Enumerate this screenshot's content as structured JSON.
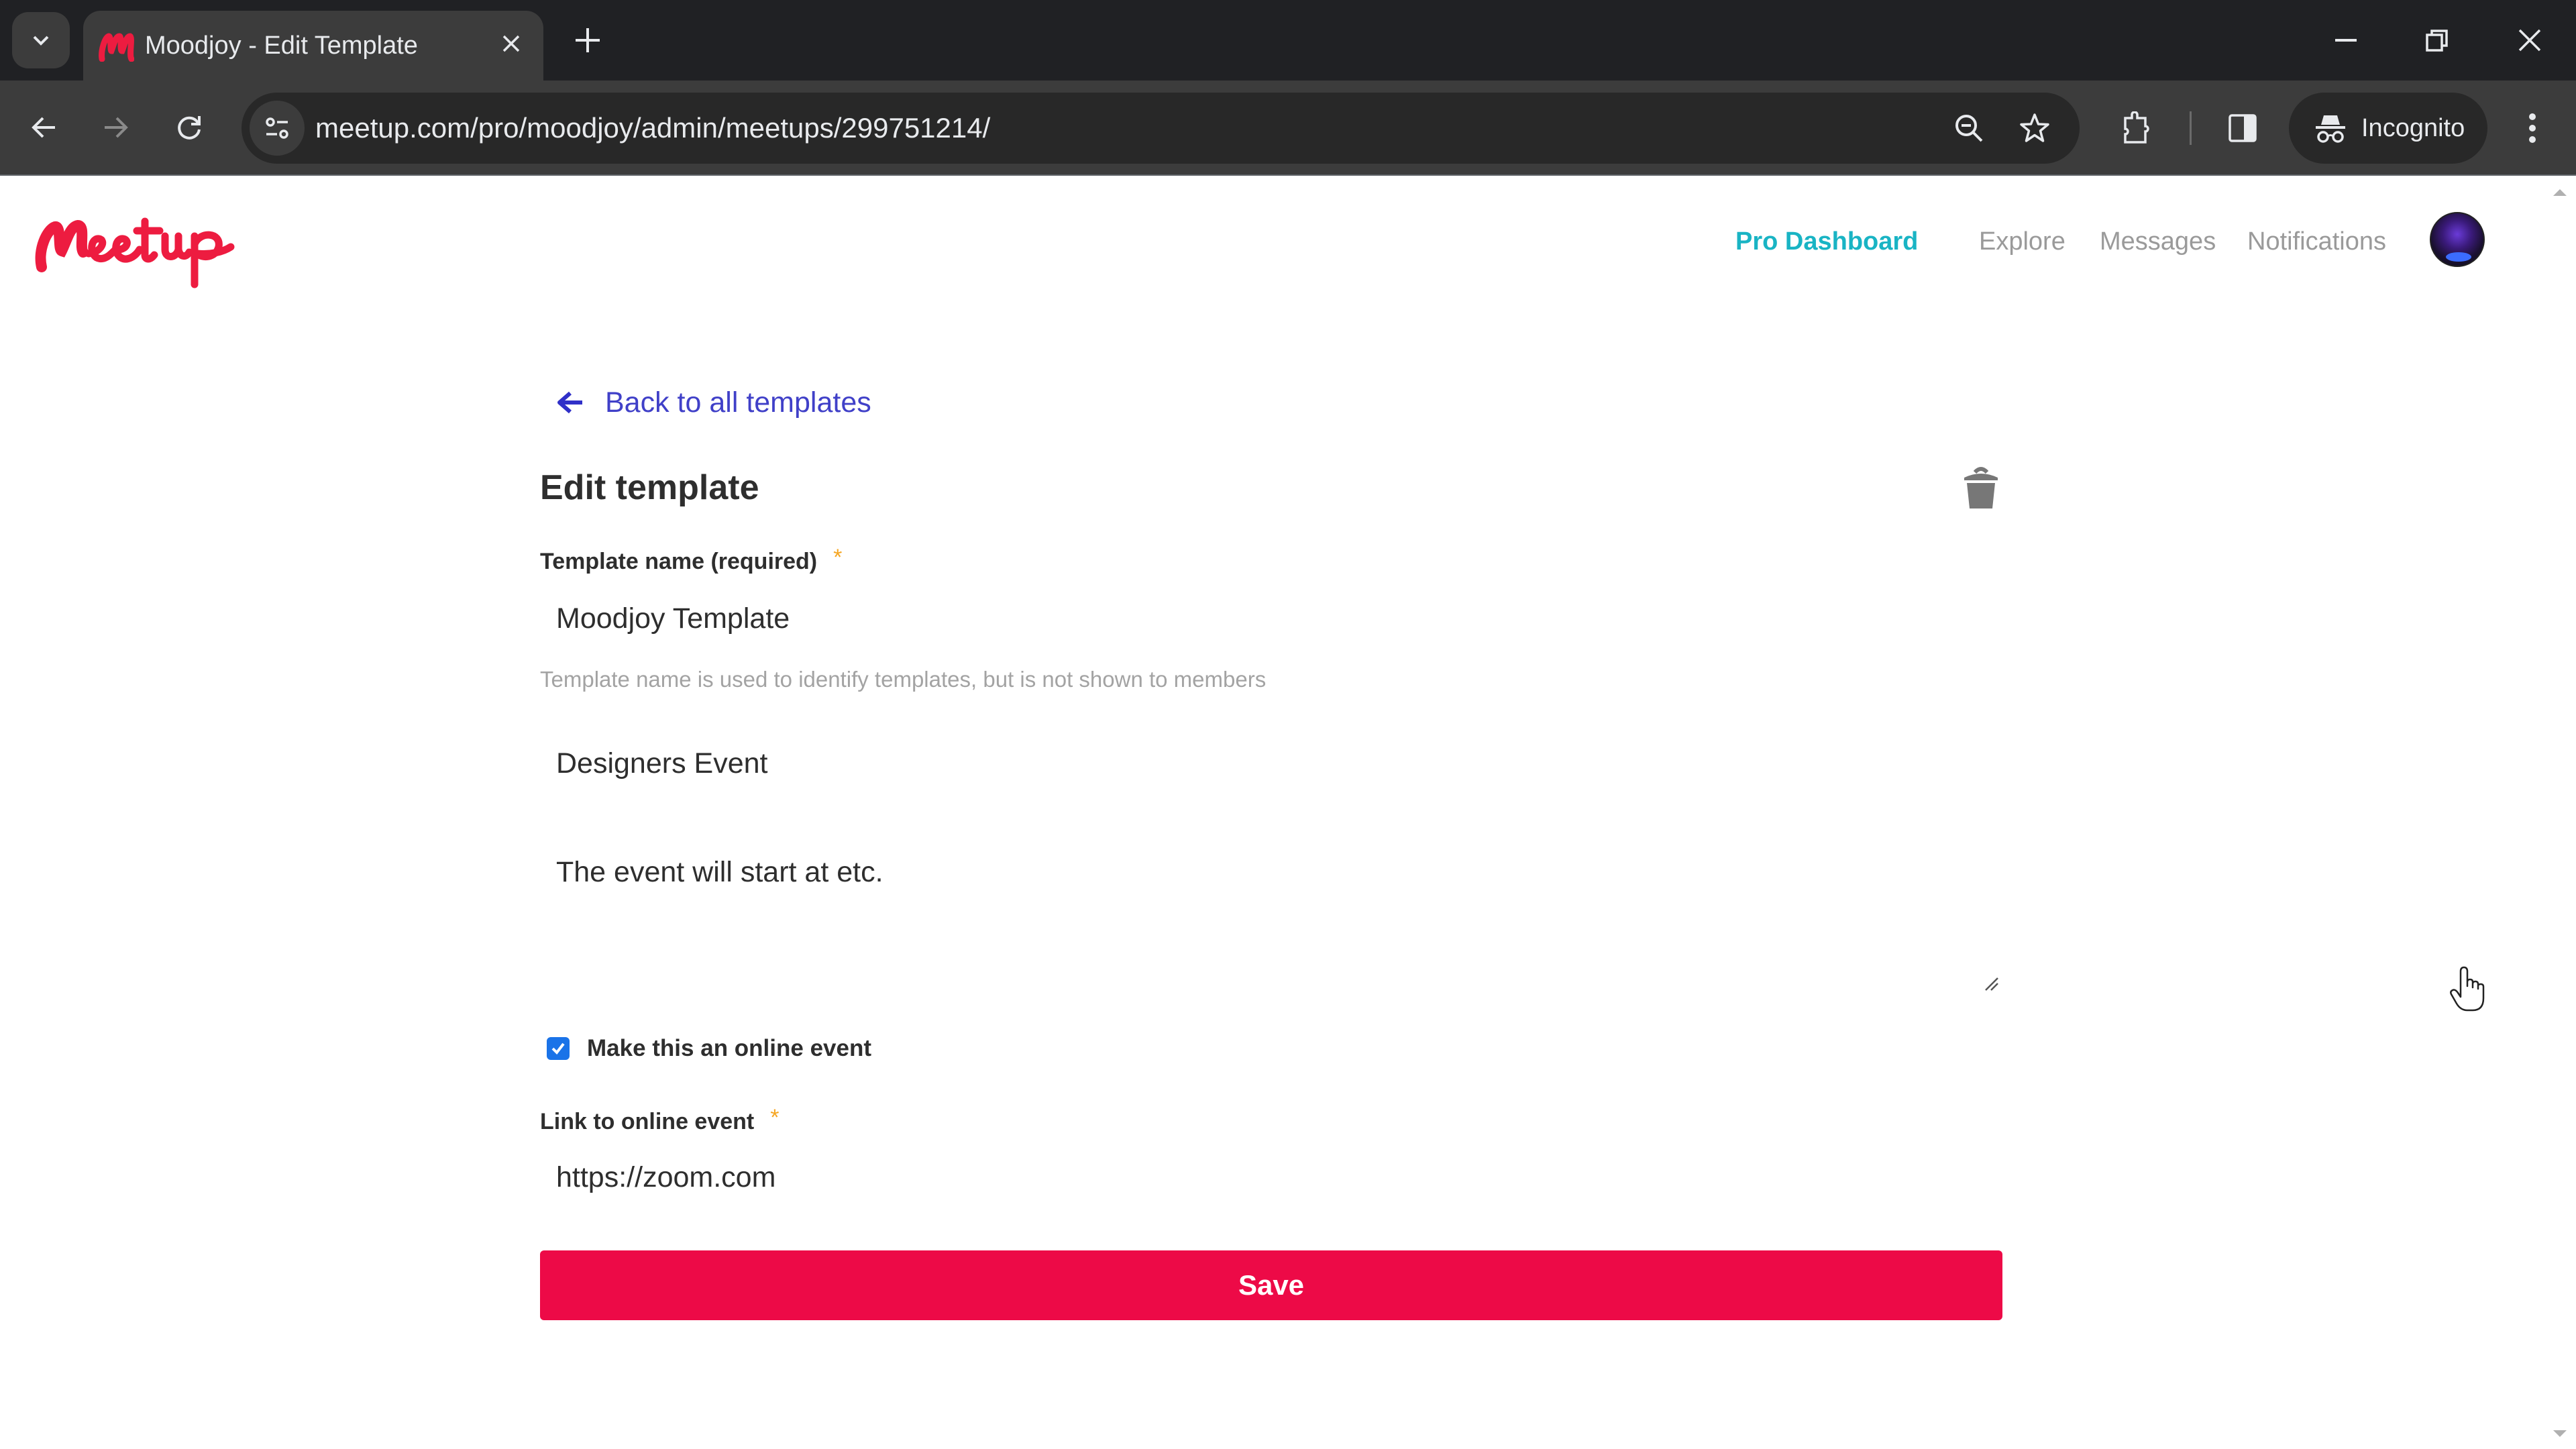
{
  "browser": {
    "tab_title": "Moodjoy - Edit Template",
    "url": "meetup.com/pro/moodjoy/admin/meetups/299751214/",
    "incognito_label": "Incognito",
    "icons": {
      "tab_search": "chevron-down-icon",
      "favicon": "meetup-favicon",
      "close_tab": "close-icon",
      "new_tab": "plus-icon",
      "minimize": "minimize-icon",
      "restore": "restore-icon",
      "close_window": "close-icon",
      "back": "arrow-left-icon",
      "forward": "arrow-right-icon",
      "reload": "reload-icon",
      "site_info": "tune-icon",
      "zoom": "zoom-out-icon",
      "bookmark": "star-icon",
      "extensions": "puzzle-icon",
      "side_panel": "side-panel-icon",
      "incognito": "incognito-icon",
      "menu": "kebab-menu-icon"
    }
  },
  "header": {
    "logo_text": "Meetup",
    "nav": {
      "pro_dashboard": "Pro Dashboard",
      "explore": "Explore",
      "messages": "Messages",
      "notifications": "Notifications"
    },
    "brand_color": "#ed1c40",
    "pro_color": "#19b4c4"
  },
  "main": {
    "back_link": "Back to all templates",
    "title": "Edit template",
    "template_name": {
      "label": "Template name (required)",
      "required_mark": "*",
      "value": "Moodjoy Template",
      "helper": "Template name is used to identify templates, but is not shown to members"
    },
    "event_title": {
      "value": "Designers Event"
    },
    "description": {
      "value": "The event will start at etc."
    },
    "online_event": {
      "label": "Make this an online event",
      "checked": true
    },
    "online_link": {
      "label": "Link to online event",
      "required_mark": "*",
      "value": "https://zoom.com"
    },
    "save_label": "Save",
    "save_color": "#ed0a47"
  }
}
